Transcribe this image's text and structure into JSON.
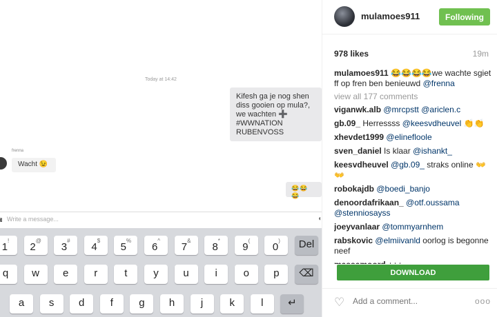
{
  "photo": {
    "timestamp": "Today at 14:42",
    "outgoing_message": "Kifesh ga je nog shen diss gooien op mula?, we wachten ➕ #WWNATION RUBENVOSS",
    "sender_name": "frenna",
    "incoming_message": "Wacht 😉",
    "emoji_message": "😂😂😂",
    "input_placeholder": "Write a message...",
    "keyboard": {
      "row1": [
        {
          "main": "1",
          "sup": "!"
        },
        {
          "main": "2",
          "sup": "@"
        },
        {
          "main": "3",
          "sup": "#"
        },
        {
          "main": "4",
          "sup": "$"
        },
        {
          "main": "5",
          "sup": "%"
        },
        {
          "main": "6",
          "sup": "^"
        },
        {
          "main": "7",
          "sup": "&"
        },
        {
          "main": "8",
          "sup": "*"
        },
        {
          "main": "9",
          "sup": "("
        },
        {
          "main": "0",
          "sup": ")"
        },
        {
          "main": "Del",
          "sup": ""
        }
      ],
      "row2": [
        "q",
        "w",
        "e",
        "r",
        "t",
        "y",
        "u",
        "i",
        "o",
        "p",
        "⌫"
      ],
      "row3": [
        "a",
        "s",
        "d",
        "f",
        "g",
        "h",
        "j",
        "k",
        "l",
        "↵"
      ]
    }
  },
  "header": {
    "username": "mulamoes911",
    "follow_label": "Following"
  },
  "stats": {
    "likes": "978 likes",
    "age": "19m"
  },
  "caption": {
    "user": "mulamoes911",
    "emojis": "😂😂😂😂",
    "text": "we wachte sgiet ff op fren ben benieuwd",
    "mention": "@frenna"
  },
  "view_all": "view all 177 comments",
  "comments": [
    {
      "user": "viganwk.alb",
      "parts": [
        {
          "t": "mention",
          "v": "@mrcpstt"
        },
        {
          "t": "text",
          "v": " "
        },
        {
          "t": "mention",
          "v": "@ariclen.c"
        }
      ]
    },
    {
      "user": "gb.09_",
      "parts": [
        {
          "t": "text",
          "v": "Herressss "
        },
        {
          "t": "mention",
          "v": "@keesvdheuvel"
        },
        {
          "t": "emoji",
          "v": " 👏👏"
        }
      ]
    },
    {
      "user": "xhevdet1999",
      "parts": [
        {
          "t": "mention",
          "v": "@elinefloole"
        }
      ]
    },
    {
      "user": "sven_daniel",
      "parts": [
        {
          "t": "text",
          "v": "Is klaar "
        },
        {
          "t": "mention",
          "v": "@ishankt_"
        }
      ]
    },
    {
      "user": "keesvdheuvel",
      "parts": [
        {
          "t": "mention",
          "v": "@gb.09_"
        },
        {
          "t": "text",
          "v": " straks online "
        },
        {
          "t": "emoji",
          "v": "👐👐"
        }
      ]
    },
    {
      "user": "robokajdb",
      "parts": [
        {
          "t": "mention",
          "v": "@boedi_banjo"
        }
      ]
    },
    {
      "user": "denoordafrikaan_",
      "parts": [
        {
          "t": "mention",
          "v": "@otf.oussama"
        },
        {
          "t": "text",
          "v": " "
        },
        {
          "t": "mention",
          "v": "@stenniosayss"
        }
      ]
    },
    {
      "user": "joeyvanlaar",
      "parts": [
        {
          "t": "mention",
          "v": "@tommyarnhem"
        }
      ]
    },
    {
      "user": "rabskovic",
      "parts": [
        {
          "t": "mention",
          "v": "@elmiivanld"
        },
        {
          "t": "text",
          "v": " oorlog is begonne neef"
        }
      ]
    },
    {
      "user": "massamoord",
      "parts": [
        {
          "t": "text",
          "v": "+++"
        }
      ]
    }
  ],
  "download_label": "DOWNLOAD",
  "footer": {
    "add_comment_placeholder": "Add a comment...",
    "more_label": "ooo"
  },
  "colors": {
    "following_green": "#70c050",
    "download_green": "#3f9f3c",
    "mention_blue": "#003569"
  },
  "icons": {
    "like": "heart-outline-icon",
    "more": "more-options-icon"
  }
}
